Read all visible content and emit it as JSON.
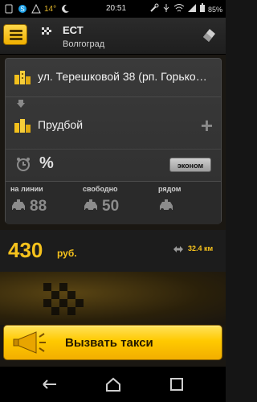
{
  "status_bar": {
    "time": "20:51",
    "temperature": "14°",
    "battery": "85%"
  },
  "header": {
    "title": "ЕСТ",
    "city": "Волгоград"
  },
  "route": {
    "from": "ул. Терешковой 38 (рп. Горько…",
    "to": "Прудбой"
  },
  "options": {
    "percent_symbol": "%",
    "tariff_label": "эконом"
  },
  "stats": {
    "online_label": "на линии",
    "online_value": "88",
    "free_label": "свободно",
    "free_value": "50",
    "near_label": "рядом",
    "near_value": ""
  },
  "price": {
    "value": "430",
    "currency": "руб.",
    "distance": "32.4 км"
  },
  "call_button": {
    "label": "Вызвать такси"
  },
  "colors": {
    "accent": "#f6c21c",
    "button_gold": "#ffc900"
  },
  "icons": {
    "menu": "menu-icon",
    "clear": "eraser-icon",
    "building": "building-icon",
    "clock": "alarm-clock-icon",
    "car": "taxi-car-icon",
    "horn": "megaphone-icon",
    "back": "back-icon",
    "home": "home-icon",
    "recents": "recents-icon"
  }
}
